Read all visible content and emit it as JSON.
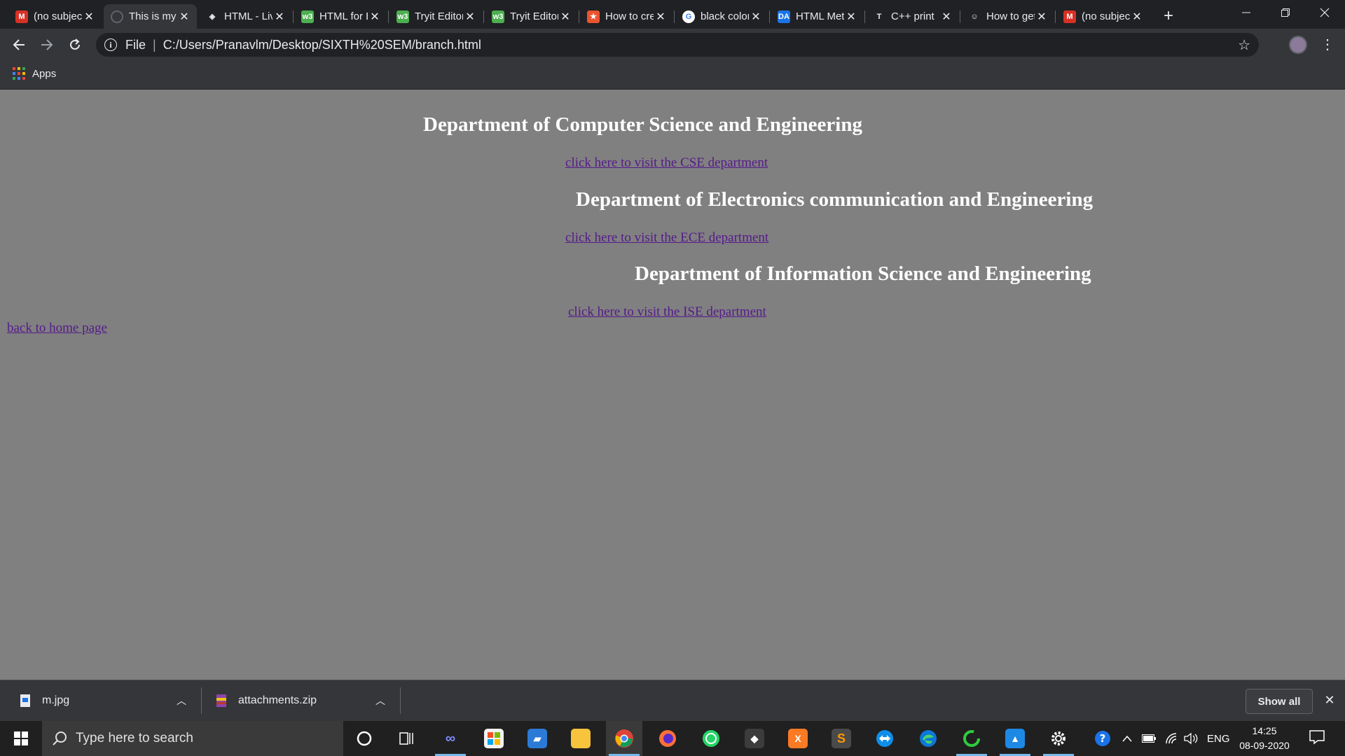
{
  "browser": {
    "tabs": [
      {
        "title": "(no subject)",
        "favicon": "gmail-icon",
        "color": "#d93025",
        "glyph": "M",
        "active": false
      },
      {
        "title": "This is my page",
        "favicon": "globe-icon",
        "color": "#5f6368",
        "glyph": "",
        "active": true
      },
      {
        "title": "HTML - Living Standard",
        "favicon": "html-logo-icon",
        "color": "#e8eaed",
        "glyph": "◈",
        "active": false
      },
      {
        "title": "HTML for Beginners",
        "favicon": "w3-icon",
        "color": "#4caf50",
        "glyph": "w3",
        "active": false
      },
      {
        "title": "Tryit Editor",
        "favicon": "w3-icon",
        "color": "#4caf50",
        "glyph": "w3",
        "active": false
      },
      {
        "title": "Tryit Editor",
        "favicon": "w3-icon",
        "color": "#4caf50",
        "glyph": "w3",
        "active": false
      },
      {
        "title": "How to create",
        "favicon": "generic-icon",
        "color": "#e8542e",
        "glyph": "★",
        "active": false
      },
      {
        "title": "black color",
        "favicon": "google-icon",
        "color": "#ffffff",
        "glyph": "G",
        "active": false
      },
      {
        "title": "HTML Meter",
        "favicon": "tutorial-icon",
        "color": "#1a73e8",
        "glyph": "DA",
        "active": false
      },
      {
        "title": "C++ print",
        "favicon": "text-icon",
        "color": "#e8eaed",
        "glyph": "T",
        "active": false
      },
      {
        "title": "How to get",
        "favicon": "user-icon",
        "color": "#e8eaed",
        "glyph": "☺",
        "active": false
      },
      {
        "title": "(no subject)",
        "favicon": "gmail-icon",
        "color": "#d93025",
        "glyph": "M",
        "active": false
      }
    ],
    "address": {
      "scheme": "File",
      "url": "C:/Users/Pranavlm/Desktop/SIXTH%20SEM/branch.html"
    },
    "bookmarks": {
      "apps_label": "Apps"
    }
  },
  "page": {
    "departments": [
      {
        "heading": "Department of Computer Science and Engineering",
        "link": "click here to visit the CSE department"
      },
      {
        "heading": "Department of Electronics communication and Engineering",
        "link": "click here to visit the ECE department"
      },
      {
        "heading": "Department of Information Science and Engineering",
        "link": "click here to visit the ISE department"
      }
    ],
    "back_link": "back to home page"
  },
  "downloads": {
    "items": [
      {
        "name": "m.jpg"
      },
      {
        "name": "attachments.zip"
      }
    ],
    "show_all": "Show all"
  },
  "taskbar": {
    "search_placeholder": "Type here to search",
    "lang": "ENG",
    "time": "14:25",
    "date": "08-09-2020"
  }
}
